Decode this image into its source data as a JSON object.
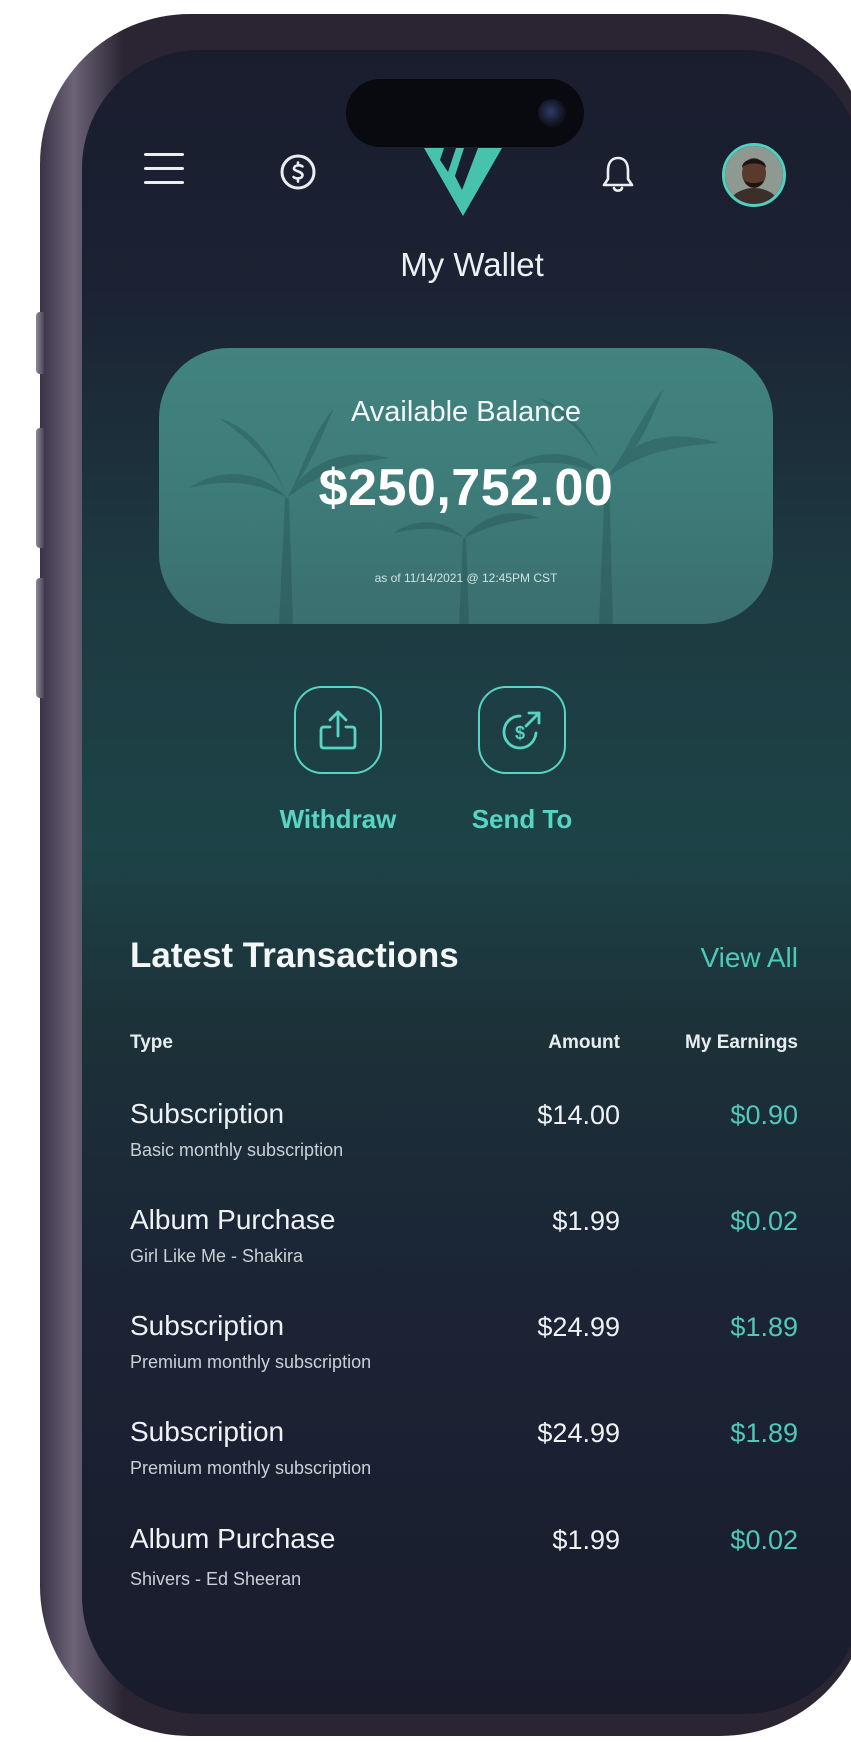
{
  "header": {
    "title": "My Wallet"
  },
  "balance": {
    "label": "Available Balance",
    "amount": "$250,752.00",
    "as_of": "as of 11/14/2021 @ 12:45PM CST"
  },
  "actions": [
    {
      "label": "Withdraw",
      "icon": "share-upload-icon"
    },
    {
      "label": "Send To",
      "icon": "dollar-send-icon"
    }
  ],
  "transactions": {
    "heading": "Latest Transactions",
    "view_all": "View All",
    "columns": {
      "type": "Type",
      "amount": "Amount",
      "earnings": "My Earnings"
    },
    "rows": [
      {
        "type": "Subscription",
        "desc": "Basic monthly subscription",
        "amount": "$14.00",
        "earnings": "$0.90"
      },
      {
        "type": "Album Purchase",
        "desc": "Girl Like Me - Shakira",
        "amount": "$1.99",
        "earnings": "$0.02"
      },
      {
        "type": "Subscription",
        "desc": "Premium monthly subscription",
        "amount": "$24.99",
        "earnings": "$1.89"
      },
      {
        "type": "Subscription",
        "desc": "Premium monthly subscription",
        "amount": "$24.99",
        "earnings": "$1.89"
      },
      {
        "type": "Album Purchase",
        "desc": "Shivers - Ed Sheeran",
        "amount": "$1.99",
        "earnings": "$0.02"
      }
    ]
  },
  "icons": {
    "menu": "menu-icon",
    "wallet": "dollar-coin-icon",
    "logo": "brand-logo-icon",
    "notifications": "bell-icon",
    "profile": "avatar"
  },
  "colors": {
    "accent": "#4fc9b8",
    "card": "#3e7c79",
    "background_top": "#1a1d2e",
    "background_mid": "#1d4347"
  }
}
